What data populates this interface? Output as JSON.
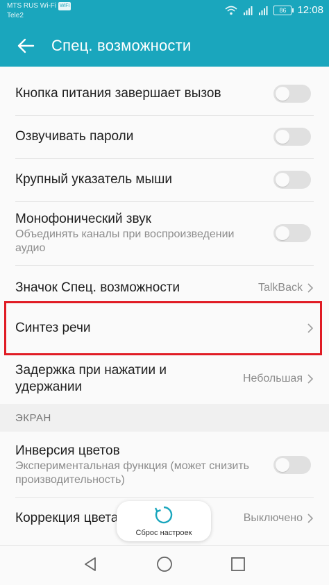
{
  "status_bar": {
    "carrier1": "MTS RUS Wi-Fi",
    "wifi_badge": "WiFi",
    "carrier2": "Tele2",
    "battery": "86",
    "time": "12:08"
  },
  "app_bar": {
    "title": "Спец. возможности",
    "back_icon": "arrow-left-icon"
  },
  "items": {
    "power_button": {
      "label": "Кнопка питания завершает вызов",
      "enabled": false
    },
    "speak_passwords": {
      "label": "Озвучивать пароли",
      "enabled": false
    },
    "large_pointer": {
      "label": "Крупный указатель мыши",
      "enabled": false
    },
    "mono_audio": {
      "label": "Монофонический звук",
      "description": "Объединять каналы при воспроизведении аудио",
      "enabled": false
    },
    "accessibility_shortcut": {
      "label": "Значок Спец. возможности",
      "value": "TalkBack"
    },
    "tts": {
      "label": "Синтез речи"
    },
    "touch_hold_delay": {
      "label": "Задержка при нажатии и удержании",
      "value": "Небольшая"
    }
  },
  "section_screen": {
    "header": "ЭКРАН",
    "color_inversion": {
      "label": "Инверсия цветов",
      "description": "Экспериментальная функция (может снизить производительность)",
      "enabled": false
    },
    "color_correction": {
      "label": "Коррекция цвета",
      "value": "Выключено"
    }
  },
  "toast": {
    "label": "Сброс настроек",
    "icon": "refresh-icon"
  },
  "nav_bar": {
    "back": "triangle-back-icon",
    "home": "circle-home-icon",
    "recents": "square-recents-icon"
  },
  "colors": {
    "accent": "#1aa6bd",
    "highlight": "#e01b24",
    "switch_off": "#e0e0e0"
  }
}
